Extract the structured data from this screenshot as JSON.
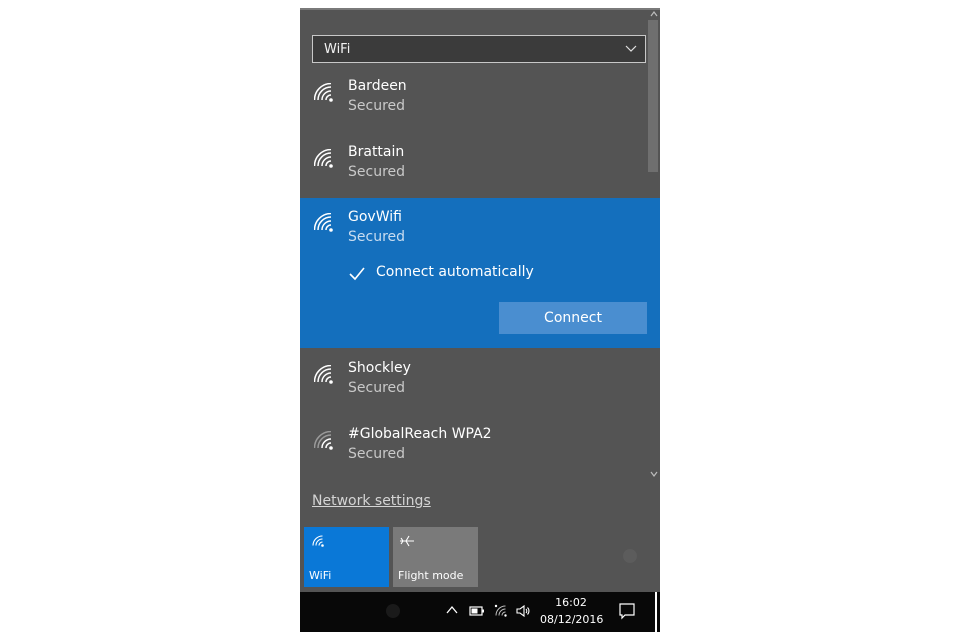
{
  "dropdown": {
    "selected": "WiFi"
  },
  "networks": [
    {
      "name": "Bardeen",
      "status": "Secured"
    },
    {
      "name": "Brattain",
      "status": "Secured"
    },
    {
      "name": "GovWifi",
      "status": "Secured"
    },
    {
      "name": "Shockley",
      "status": "Secured"
    },
    {
      "name": "#GlobalReach WPA2",
      "status": "Secured"
    }
  ],
  "selected_network": {
    "connect_automatically_label": "Connect automatically",
    "connect_automatically_checked": true,
    "connect_button": "Connect"
  },
  "network_settings_link": "Network settings",
  "quick_actions": [
    {
      "label": "WiFi",
      "icon": "wifi-icon",
      "active": true
    },
    {
      "label": "Flight mode",
      "icon": "airplane-icon",
      "active": false
    }
  ],
  "taskbar": {
    "time": "16:02",
    "date": "08/12/2016"
  },
  "colors": {
    "flyout_bg": "#545454",
    "selected_bg": "#146fbd",
    "accent_tile": "#0a78d7",
    "inactive_tile": "#7a7a7a",
    "taskbar_bg": "#080808"
  }
}
